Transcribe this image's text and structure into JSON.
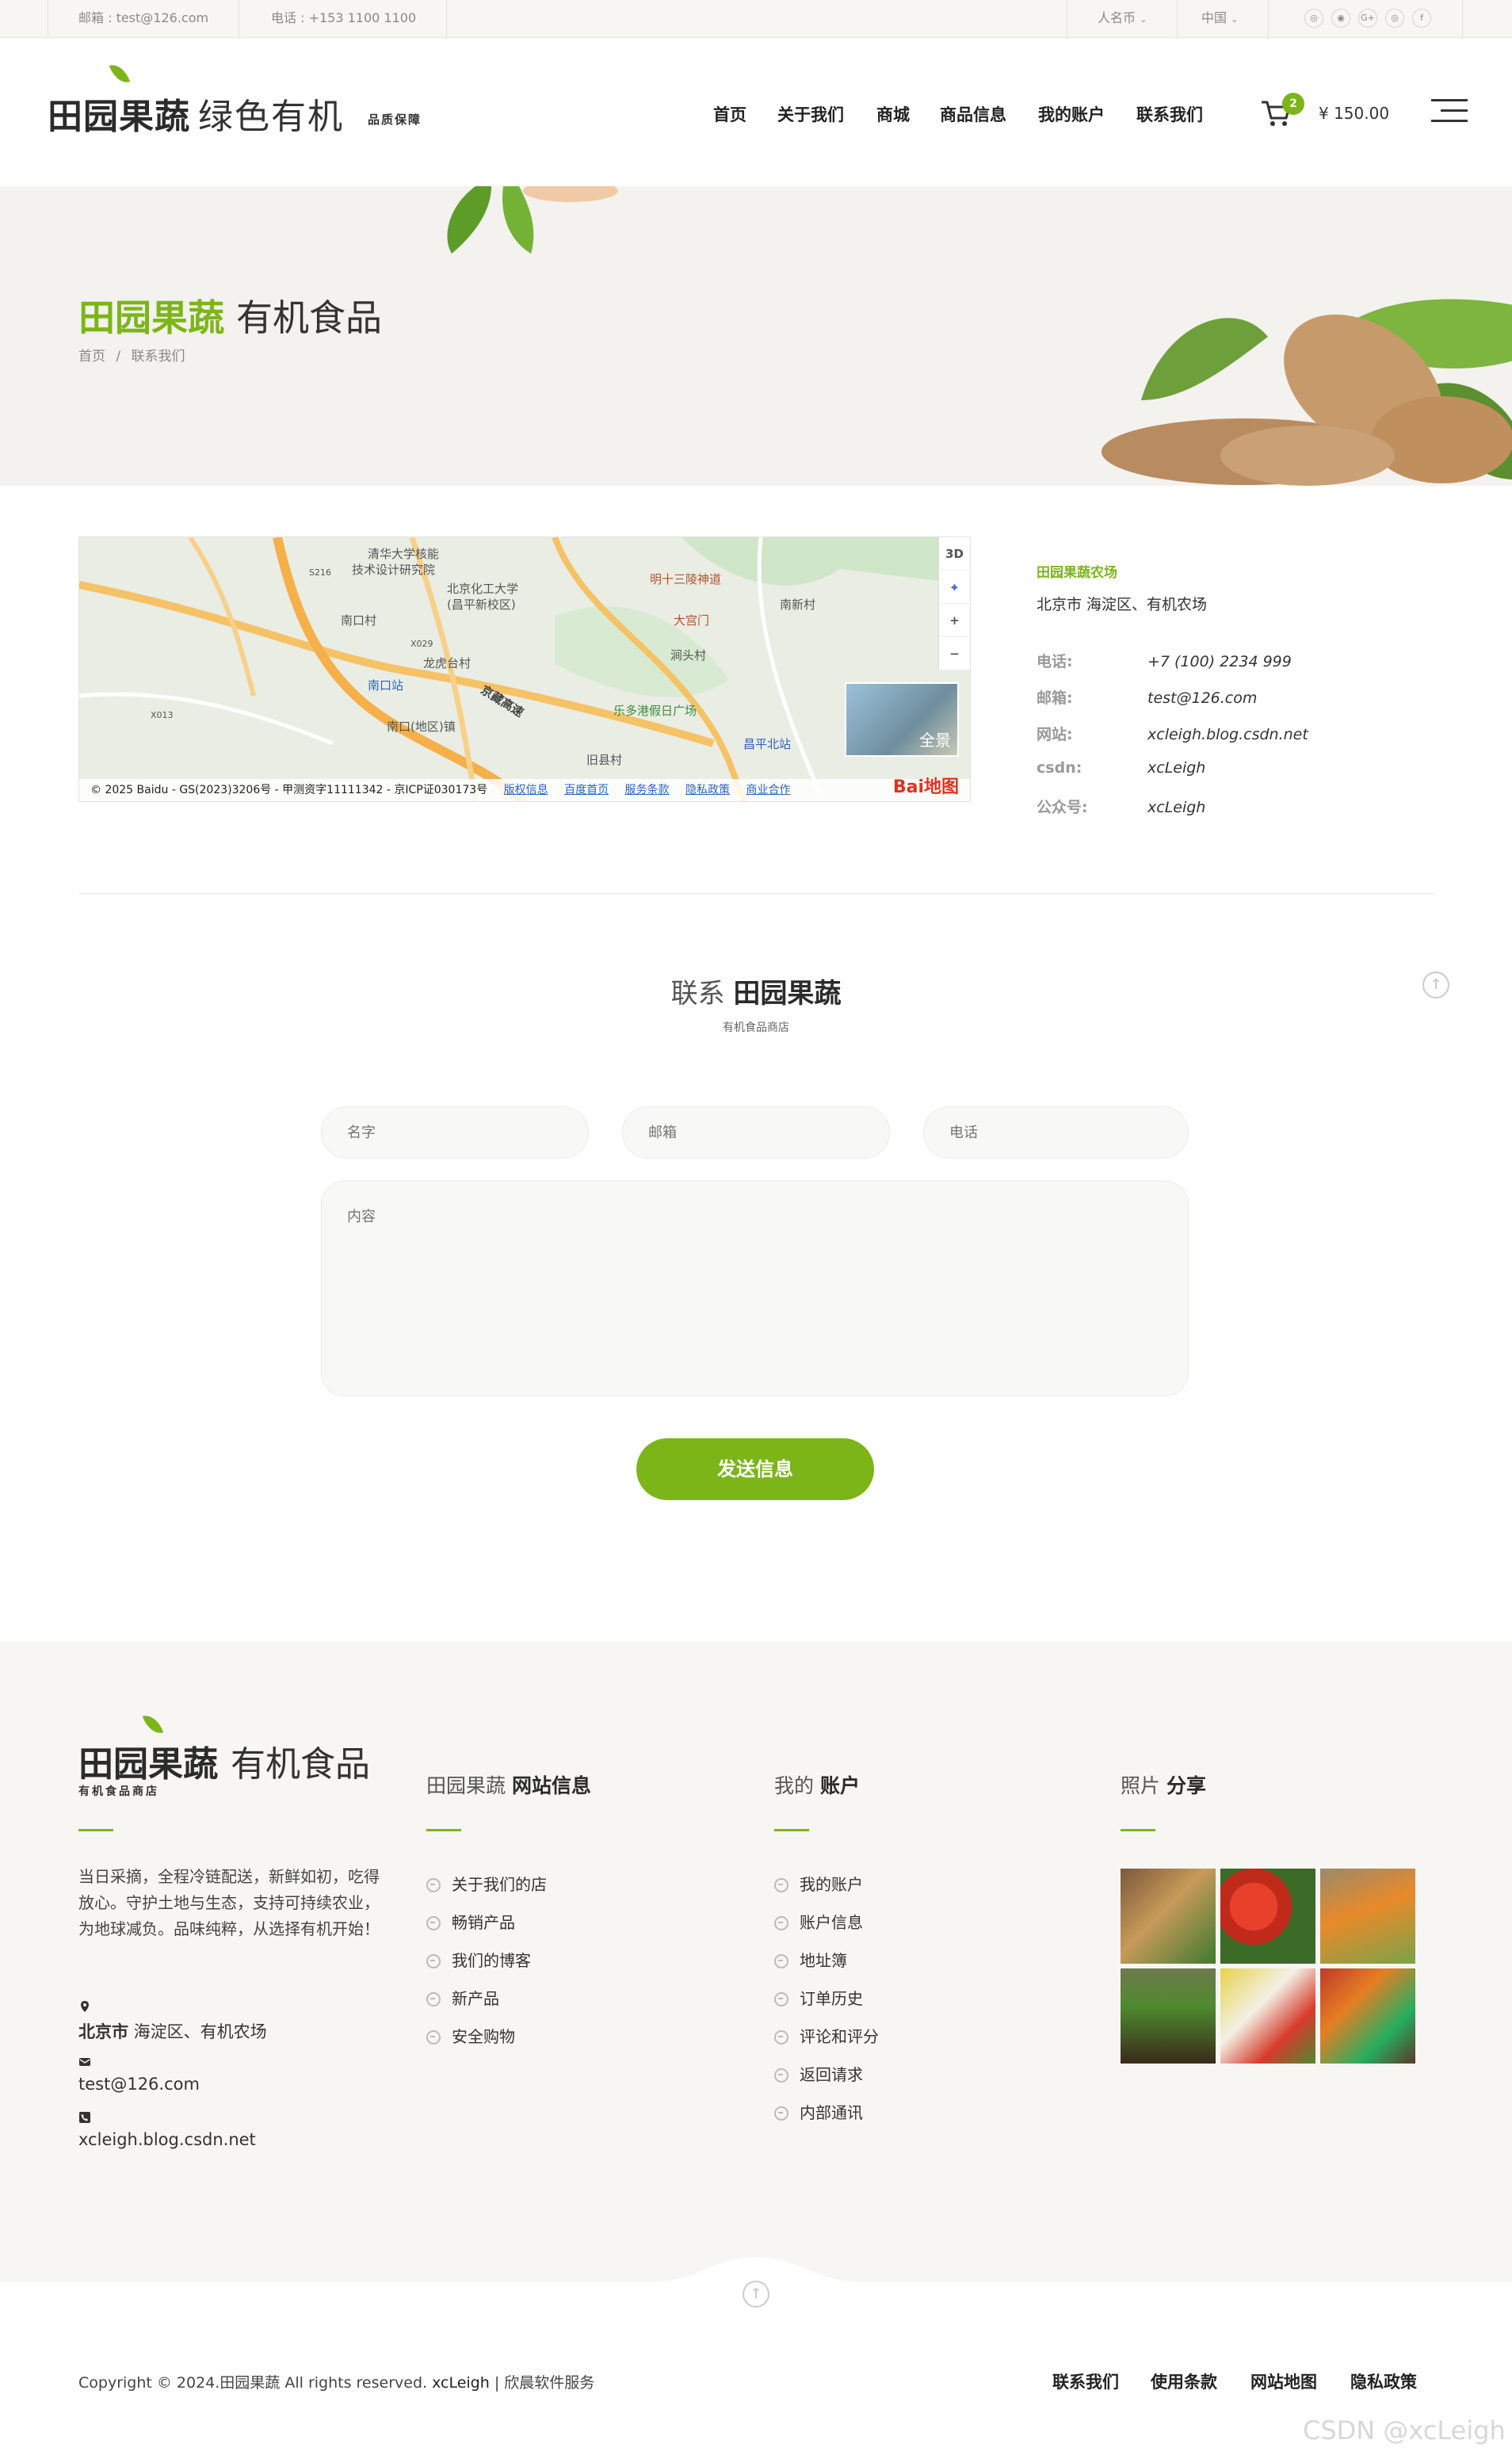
{
  "topbar": {
    "email": "邮箱 : test@126.com",
    "phone": "电话 : +153 1100 1100",
    "currency": "人名币",
    "country": "中国",
    "social": [
      "wechat-icon",
      "qq-icon",
      "google-plus-icon",
      "instagram-icon",
      "facebook-icon"
    ],
    "social_glyphs": [
      "◎",
      "◉",
      "G+",
      "◎",
      "f"
    ]
  },
  "header": {
    "logo_main": "田园果蔬",
    "logo_sub": "绿色有机",
    "logo_tag": "品质保障",
    "nav": [
      "首页",
      "关于我们",
      "商城",
      "商品信息",
      "我的账户",
      "联系我们"
    ],
    "cart_count": "2",
    "cart_total": "¥ 150.00"
  },
  "banner": {
    "title_accent": "田园果蔬",
    "title_rest": "有机食品",
    "breadcrumb": [
      "首页",
      "/",
      "联系我们"
    ]
  },
  "map": {
    "labels": [
      "清华大学核能",
      "技术设计研究院",
      "北京化工大学",
      "(昌平新校区)",
      "南口村",
      "龙虎台村",
      "南口站",
      "南口(地区)镇",
      "明十三陵神道",
      "大宫门",
      "南新村",
      "涧头村",
      "乐多港假日广场",
      "昌平北站",
      "旧县村",
      "京藏高速",
      "X029",
      "X013",
      "S216"
    ],
    "controls": [
      "3D",
      "⌖",
      "+",
      "−"
    ],
    "pano_label": "全景",
    "copyright": "© 2025 Baidu - GS(2023)3206号 - 甲测资字11111342 - 京ICP证030173号",
    "links": [
      "版权信息",
      "百度首页",
      "服务条款",
      "隐私政策",
      "商业合作"
    ],
    "logo": "Bai地图"
  },
  "info": {
    "title": "田园果蔬农场",
    "address": "北京市 海淀区、有机农场",
    "rows": [
      {
        "k": "电话:",
        "v": "+7 (100) 2234 999"
      },
      {
        "k": "邮箱:",
        "v": "test@126.com"
      },
      {
        "k": "网站:",
        "v": "xcleigh.blog.csdn.net"
      },
      {
        "k": "csdn:",
        "v": "xcLeigh"
      },
      {
        "k": "公众号:",
        "v": "xcLeigh"
      }
    ]
  },
  "form": {
    "title_pre": "联系",
    "title_bold": "田园果蔬",
    "subtitle": "有机食品商店",
    "name_placeholder": "名字",
    "email_placeholder": "邮箱",
    "phone_placeholder": "电话",
    "content_placeholder": "内容",
    "submit": "发送信息"
  },
  "footer": {
    "logo_a": "田园果蔬",
    "logo_b": "有机食品",
    "logo_tag": "有机食品商店",
    "about": "当日采摘，全程冷链配送，新鲜如初，吃得放心。守护土地与生态，支持可持续农业，为地球减负。品味纯粹，从选择有机开始！",
    "address_bold": "北京市",
    "address_rest": " 海淀区、有机农场",
    "email": "test@126.com",
    "website": "xcleigh.blog.csdn.net",
    "col1_pre": "田园果蔬",
    "col1_bold": "网站信息",
    "col1_links": [
      "关于我们的店",
      "畅销产品",
      "我们的博客",
      "新产品",
      "安全购物"
    ],
    "col2_pre": "我的",
    "col2_bold": "账户",
    "col2_links": [
      "我的账户",
      "账户信息",
      "地址簿",
      "订单历史",
      "评论和评分",
      "返回请求",
      "内部通讯"
    ],
    "col3_pre": "照片",
    "col3_bold": "分享"
  },
  "bottom": {
    "copyright_a": "Copyright © 2024.田园果蔬 All rights reserved.",
    "copyright_b": "xcLeigh",
    "copyright_c": "| 欣晨软件服务",
    "links": [
      "联系我们",
      "使用条款",
      "网站地图",
      "隐私政策"
    ],
    "watermark": "CSDN @xcLeigh"
  },
  "colors": {
    "accent": "#7cb518",
    "background_light": "#f3f2ee",
    "text_dark": "#2b2b2b"
  }
}
